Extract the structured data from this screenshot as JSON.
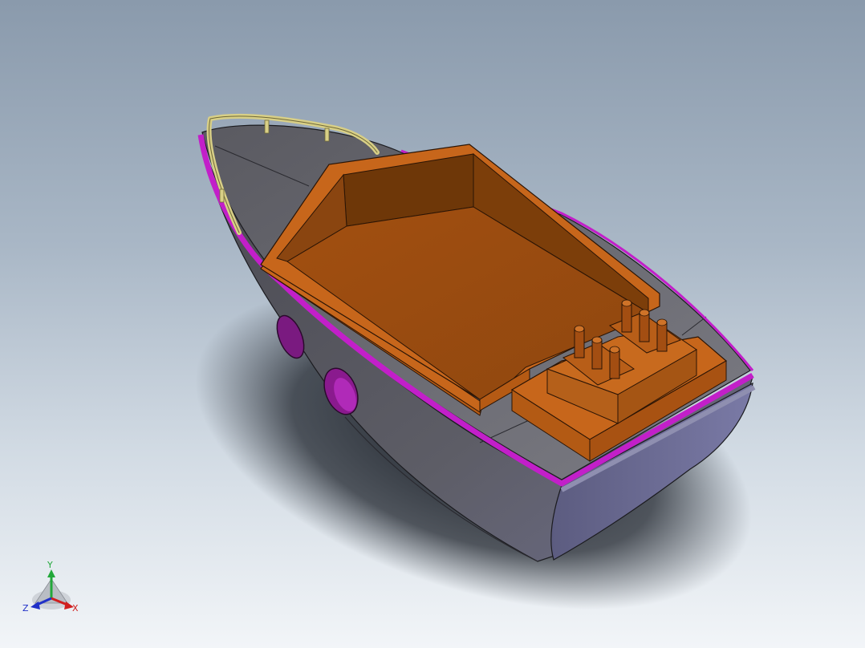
{
  "viewport": {
    "background_top": "#8a9aac",
    "background_bottom": "#f2f5f8"
  },
  "model": {
    "hull_color": "#5f5f67",
    "hull_underside_color": "#6a6a88",
    "deck_color": "#6b6b73",
    "gunwale_color": "#c21fc9",
    "cabin_color": "#c7661b",
    "cabin_interior_color": "#9a4c12",
    "rail_color": "#d8cf86",
    "porthole_color": "#8a1a8e"
  },
  "triad": {
    "x_label": "X",
    "y_label": "Y",
    "z_label": "Z",
    "x_color": "#d01e1e",
    "y_color": "#22a83a",
    "z_color": "#2030c8"
  }
}
